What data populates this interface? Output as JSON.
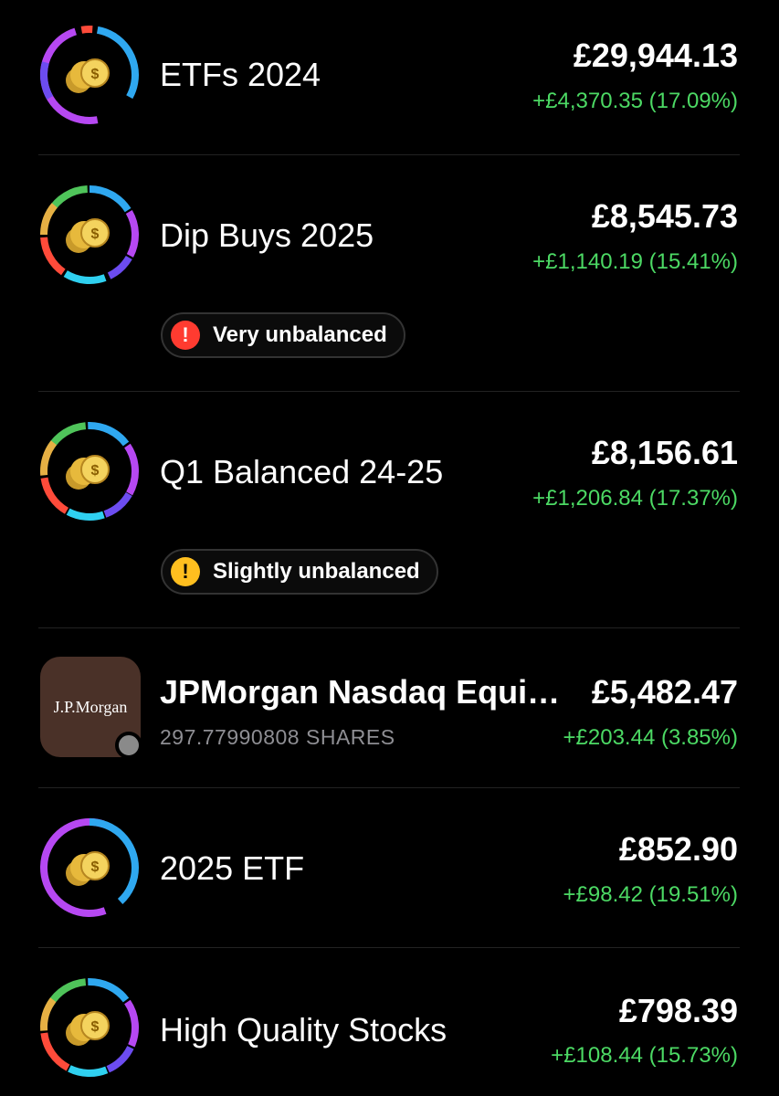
{
  "holdings": [
    {
      "name": "ETFs 2024",
      "value": "£29,944.13",
      "gain": "+£4,370.35 (17.09%)",
      "icon": "coin-stack-icon"
    },
    {
      "name": "Dip Buys 2025",
      "value": "£8,545.73",
      "gain": "+£1,140.19 (15.41%)",
      "icon": "coin-stack-icon",
      "badge": {
        "label": "Very unbalanced",
        "icon": "alert-icon",
        "icon_glyph": "!",
        "color": "#ff3b30"
      }
    },
    {
      "name": "Q1 Balanced 24-25",
      "value": "£8,156.61",
      "gain": "+£1,206.84 (17.37%)",
      "icon": "coin-stack-icon",
      "badge": {
        "label": "Slightly unbalanced",
        "icon": "warning-icon",
        "icon_glyph": "!",
        "color": "#ffbf1f"
      }
    },
    {
      "name": "JPMorgan Nasdaq Equi…",
      "sub": "297.77990808 SHARES",
      "value": "£5,482.47",
      "gain": "+£203.44 (3.85%)",
      "logo_text": "J.P.Morgan"
    },
    {
      "name": "2025 ETF",
      "value": "£852.90",
      "gain": "+£98.42 (19.51%)",
      "icon": "coin-stack-icon"
    },
    {
      "name": "High Quality Stocks",
      "value": "£798.39",
      "gain": "+£108.44 (15.73%)",
      "icon": "coin-stack-icon"
    }
  ],
  "colors": {
    "gain": "#4cd964",
    "ring_palette": [
      "#2fa8f0",
      "#b648f2",
      "#ff4b3a",
      "#e6b044",
      "#2fd0f0",
      "#6c4cf0",
      "#4fc45a"
    ]
  }
}
